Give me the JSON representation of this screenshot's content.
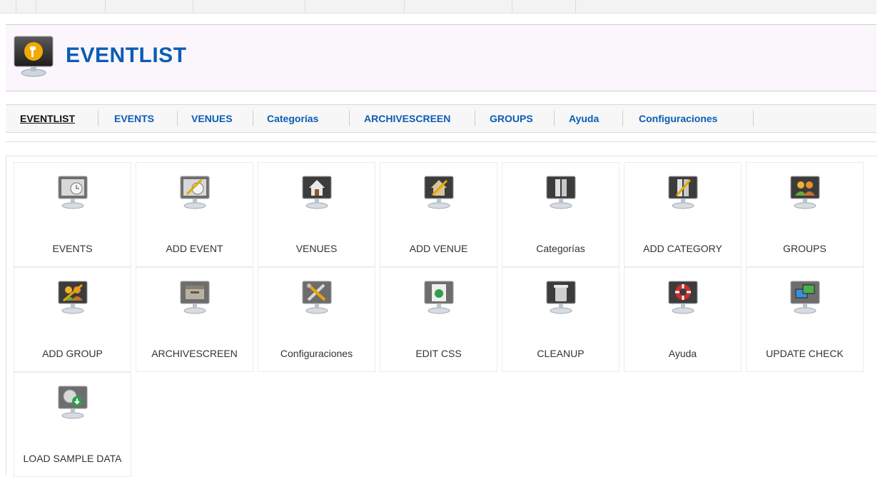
{
  "header": {
    "title": "EVENTLIST"
  },
  "submenu": [
    {
      "label": "EVENTLIST",
      "active": true
    },
    {
      "label": "EVENTS"
    },
    {
      "label": "VENUES"
    },
    {
      "label": "Categorías"
    },
    {
      "label": "ARCHIVESCREEN"
    },
    {
      "label": "GROUPS"
    },
    {
      "label": "Ayuda"
    },
    {
      "label": "Configuraciones"
    }
  ],
  "panel": {
    "items": [
      {
        "label": "EVENTS",
        "icon": "events-icon"
      },
      {
        "label": "ADD EVENT",
        "icon": "add-event-icon"
      },
      {
        "label": "VENUES",
        "icon": "venues-icon"
      },
      {
        "label": "ADD VENUE",
        "icon": "add-venue-icon"
      },
      {
        "label": "Categorías",
        "icon": "categories-icon"
      },
      {
        "label": "ADD CATEGORY",
        "icon": "add-category-icon"
      },
      {
        "label": "GROUPS",
        "icon": "groups-icon"
      },
      {
        "label": "ADD GROUP",
        "icon": "add-group-icon"
      },
      {
        "label": "ARCHIVESCREEN",
        "icon": "archive-icon"
      },
      {
        "label": "Configuraciones",
        "icon": "tools-icon"
      },
      {
        "label": "EDIT CSS",
        "icon": "css-icon"
      },
      {
        "label": "CLEANUP",
        "icon": "trash-icon"
      },
      {
        "label": "Ayuda",
        "icon": "help-icon"
      },
      {
        "label": "UPDATE CHECK",
        "icon": "update-icon"
      },
      {
        "label": "LOAD SAMPLE DATA",
        "icon": "sample-data-icon"
      }
    ]
  },
  "colors": {
    "accent": "#0b5db4",
    "header_bg": "#fbf6fb"
  }
}
